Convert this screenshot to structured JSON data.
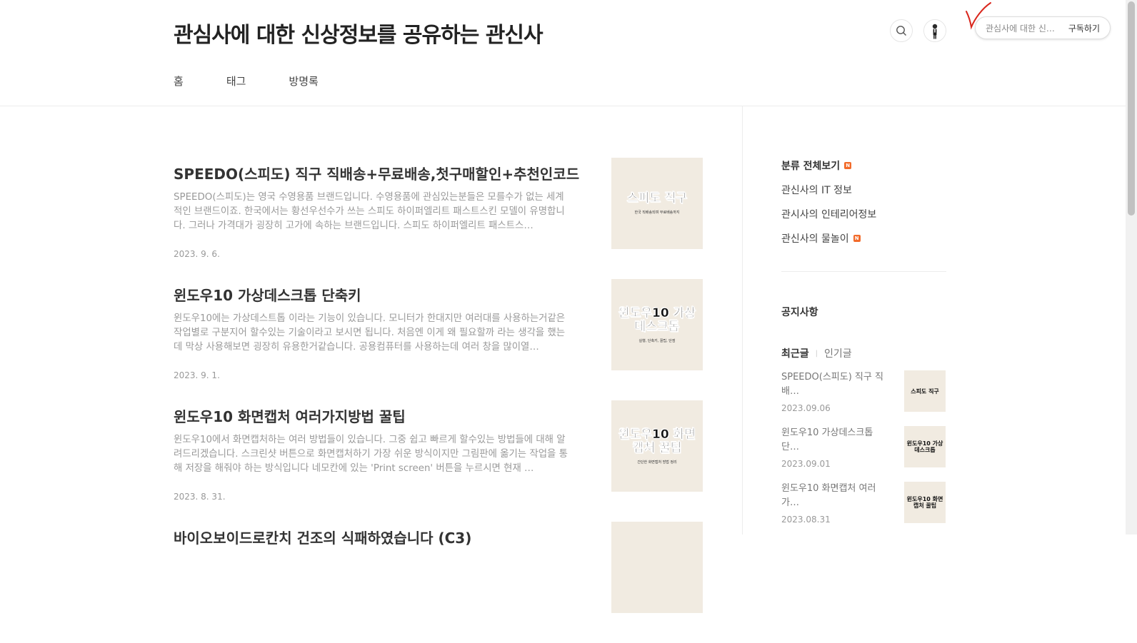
{
  "header": {
    "blog_title": "관심사에 대한 신상정보를 공유하는 관신사",
    "nav": [
      "홈",
      "태그",
      "방명록"
    ],
    "subscribe_name": "관심사에 대한 신…",
    "subscribe_label": "구독하기"
  },
  "posts": [
    {
      "title": "SPEEDO(스피도) 직구 직배송+무료배송,첫구매할인+추천인코드",
      "excerpt": "SPEEDO(스피도)는 영국 수영용품 브랜드입니다. 수영용품에 관심있는분들은 모를수가 없는 세계적인 브랜드이죠. 한국에서는 황선우선수가 쓰는 스피도 하이퍼엘리트 패스트스킨 모델이 유명합니다. 그러나 가격대가 굉장히 고가에 속하는 브랜드입니다. 스피도 하이퍼엘리트 패스트스…",
      "date": "2023. 9. 6.",
      "thumb_line1": "스피도 직구",
      "thumb_line2": "한국 직배송되며 무료배송까지"
    },
    {
      "title": "윈도우10 가상데스크톱 단축키",
      "excerpt": "윈도우10에는 가상데스트톱 이라는 기능이 있습니다. 모니터가 한대지만 여러대를 사용하는거같은 작업별로 구분지어 할수있는 기술이라고 보시면 됩니다. 처음엔 이게 왜 필요할까 라는 생각을 했는데 막상 사용해보면 굉장히 유용한거같습니다. 공용컴퓨터를 사용하는데 여러 창을 많이열…",
      "date": "2023. 9. 1.",
      "thumb_line1": "윈도우10 가상데스크톱",
      "thumb_line2": "실행, 단축키, 꿀팁, 단점"
    },
    {
      "title": "윈도우10 화면캡처 여러가지방법 꿀팁",
      "excerpt": "윈도우10에서 화면캡처하는 여러 방법들이 있습니다. 그중 쉽고 빠르게 할수있는 방법들에 대해 알려드리겠습니다. 스크린샷 버튼으로 화면캡처하기 가장 쉬운 방식이지만 그림판에 옮기는 작업을 통해 저장을 해줘야 하는 방식입니다 네모칸에 있는 'Print screen' 버튼을 누르시면 현재 …",
      "date": "2023. 8. 31.",
      "thumb_line1": "윈도우10 화면캡처 꿀팁",
      "thumb_line2": "간단한 화면캡처 방법 정리"
    },
    {
      "title": "바이오보이드로칸치 건조의 식패하였습니다 (C3)",
      "excerpt": "",
      "date": "",
      "thumb_line1": "",
      "thumb_line2": ""
    }
  ],
  "sidebar": {
    "category_all": "분류 전체보기",
    "new_badge": "N",
    "categories": [
      "관신사의 IT 정보",
      "관시사의 인테리어정보",
      "관신사의 물놀이"
    ],
    "notice": "공지사항",
    "tab_recent": "최근글",
    "tab_popular": "인기글",
    "recent": [
      {
        "title": "SPEEDO(스피도) 직구 직배…",
        "date": "2023.09.06",
        "thumb": "스피도 직구"
      },
      {
        "title": "윈도우10 가상데스크톱 단…",
        "date": "2023.09.01",
        "thumb": "윈도우10 가상데스크톱"
      },
      {
        "title": "윈도우10 화면캡처 여러가…",
        "date": "2023.08.31",
        "thumb": "윈도우10 화면캡처 꿀팁"
      }
    ]
  },
  "colors": {
    "accent_mark": "#d9261c",
    "thumb_bg": "#f1ebe1",
    "new_badge": "#f26b2b"
  },
  "icons": [
    "search-icon",
    "avatar-icon",
    "checkmark-annotation",
    "new-badge-icon"
  ]
}
